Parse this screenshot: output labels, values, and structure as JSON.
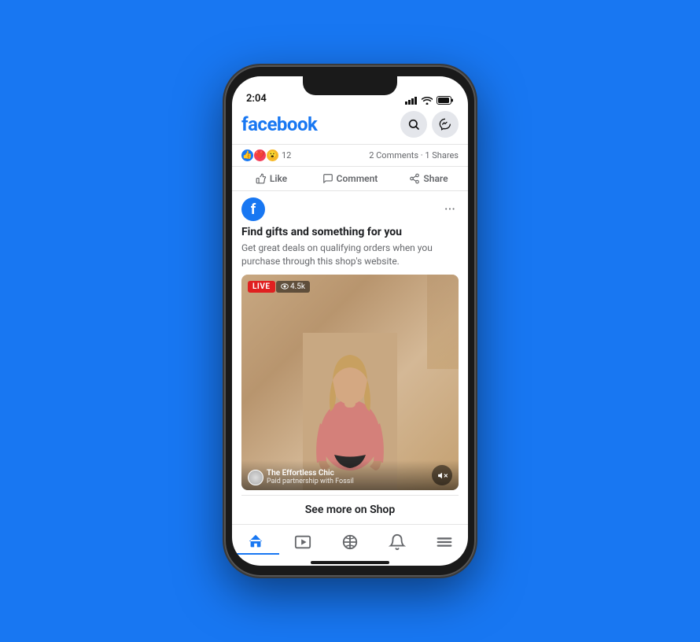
{
  "background_color": "#1877F2",
  "phone": {
    "status_bar": {
      "time": "2:04",
      "icons": [
        "signal",
        "wifi",
        "battery"
      ]
    },
    "header": {
      "logo": "facebook",
      "search_label": "Search",
      "messenger_label": "Messenger"
    },
    "reactions": {
      "count": "12",
      "stats": "2 Comments · 1 Shares"
    },
    "actions": {
      "like": "Like",
      "comment": "Comment",
      "share": "Share"
    },
    "ad_card": {
      "headline": "Find gifts and something for you",
      "description": "Get great deals on qualifying orders when you purchase through this shop's website.",
      "live_badge": "LIVE",
      "viewers": "4.5k",
      "channel_name": "The Effortless Chic",
      "channel_subtitle": "Paid partnership with Fossil",
      "see_more": "See more on Shop"
    },
    "bottom_nav": {
      "items": [
        "Home",
        "Watch",
        "Marketplace",
        "Notifications",
        "Menu"
      ]
    }
  }
}
